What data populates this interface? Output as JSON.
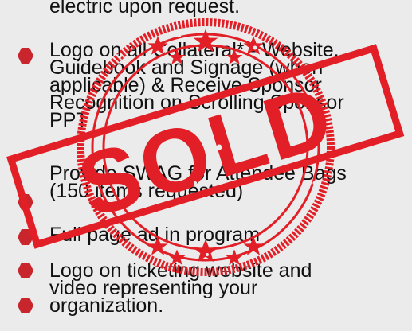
{
  "items": [
    {
      "lines": [
        "electric upon request."
      ]
    },
    {
      "lines": [
        "Logo on all Collateral* - Website,",
        "Guidebook and Signage (when",
        "applicable) & Receive Sponsor",
        "Recognition on Scrolling Sponsor",
        "PPT"
      ]
    },
    {
      "lines": [
        "Provide SWAG for Attendee Bags",
        "(150 items requested)"
      ]
    },
    {
      "lines": [
        "Full page ad in program"
      ]
    },
    {
      "lines": [
        "Logo on ticketing website and",
        "video representing your",
        "organization."
      ]
    }
  ],
  "stamp": {
    "text": "SOLD",
    "color": "#e21f26"
  }
}
